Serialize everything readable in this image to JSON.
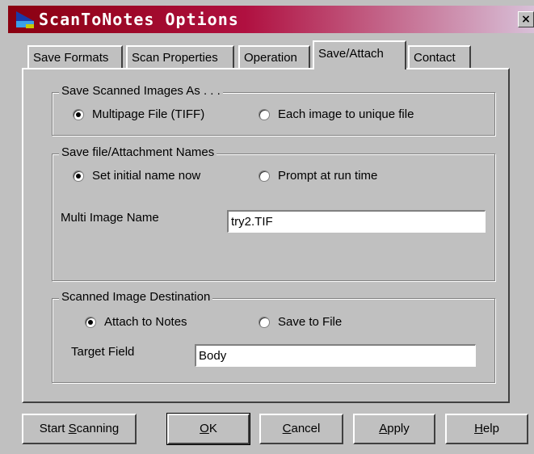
{
  "window": {
    "title": "ScanToNotes Options",
    "close_label": "×"
  },
  "tabs": [
    {
      "label": "Save Formats",
      "active": false
    },
    {
      "label": "Scan Properties",
      "active": false
    },
    {
      "label": "Operation",
      "active": false
    },
    {
      "label": "Save/Attach",
      "active": true
    },
    {
      "label": "Contact",
      "active": false
    }
  ],
  "save_images": {
    "legend": "Save Scanned Images As . . .",
    "options": [
      {
        "label": "Multipage File (TIFF)",
        "checked": true
      },
      {
        "label": "Each image to unique file",
        "checked": false
      }
    ]
  },
  "names": {
    "legend": "Save file/Attachment Names",
    "options": [
      {
        "label": "Set initial name now",
        "checked": true
      },
      {
        "label": "Prompt at run time",
        "checked": false
      }
    ],
    "multi_image_label": "Multi Image Name",
    "multi_image_value": "try2.TIF"
  },
  "destination": {
    "legend": "Scanned Image Destination",
    "options": [
      {
        "label": "Attach to Notes",
        "checked": true
      },
      {
        "label": "Save to File",
        "checked": false
      }
    ],
    "target_field_label": "Target Field",
    "target_field_value": "Body"
  },
  "buttons": {
    "start_scanning": {
      "before": "Start ",
      "key": "S",
      "after": "canning"
    },
    "ok": {
      "before": "",
      "key": "O",
      "after": "K"
    },
    "cancel": {
      "before": "",
      "key": "C",
      "after": "ancel"
    },
    "apply": {
      "before": "",
      "key": "A",
      "after": "pply"
    },
    "help": {
      "before": "",
      "key": "H",
      "after": "elp"
    }
  }
}
